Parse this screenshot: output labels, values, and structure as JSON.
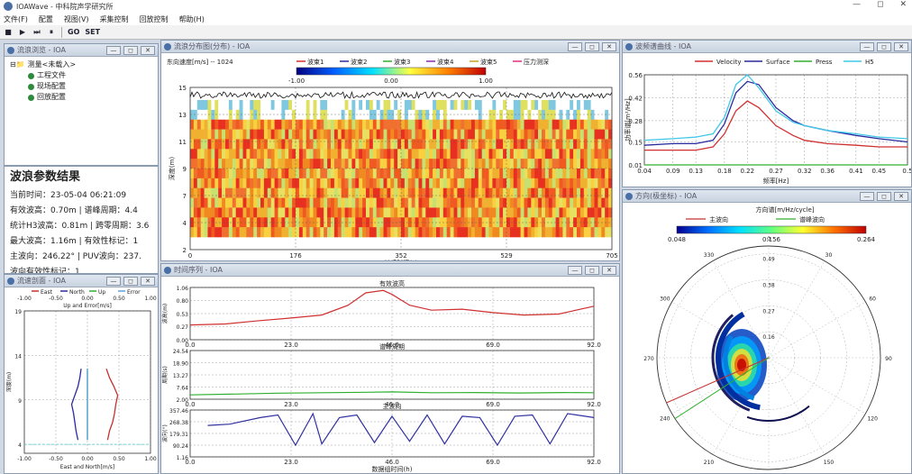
{
  "window": {
    "title": "IOAWave - 中科院声学研究所",
    "min": "—",
    "max": "◻",
    "close": "✕"
  },
  "menu": [
    "文件(F)",
    "配置",
    "视图(V)",
    "采集控制",
    "回放控制",
    "帮助(H)"
  ],
  "toolbar": {
    "go": "GO",
    "set": "SET"
  },
  "panels": {
    "tree": {
      "title": "流浪浏览 - IOA"
    },
    "heatmap": {
      "title": "流浪分布图(分布) - IOA"
    },
    "spectrum": {
      "title": "波频谱曲线 - IOA"
    },
    "direction": {
      "title": "方向(极坐标) - IOA"
    },
    "timeseries": {
      "title": "时间序列 - IOA"
    },
    "profile": {
      "title": "流速剖面 - IOA"
    }
  },
  "tree": {
    "root": "测量<未载入>",
    "items": [
      "工程文件",
      "现场配置",
      "回放配置"
    ]
  },
  "params": {
    "title": "波浪参数结果",
    "rows": [
      "当前时间：23-05-04 06:21:09",
      "有效波高：0.70m   | 谱峰周期：4.4",
      "统计H3波高：0.81m | 跨零周期：3.6",
      "最大波高：1.16m   | 有效性标记：1",
      "主波向：246.22°   | PUV波向：237.",
      "波向有效性标记：1"
    ]
  },
  "heatmap": {
    "caption": "东向速度[m/s] -- 1024",
    "legend": [
      "波束1",
      "波束2",
      "波束3",
      "波束4",
      "波束5",
      "压力测深"
    ],
    "colorbar_ticks": [
      "-1.00",
      "0.00",
      "1.00"
    ],
    "ylabel": "深度(m)",
    "xlabel": "持续时间(s)"
  },
  "spectrum_legend": [
    "Velocity",
    "Surface",
    "Press",
    "H5"
  ],
  "direction": {
    "title": "方向谱[m/Hz/cycle]",
    "legend": [
      "主波向",
      "谱峰波向"
    ],
    "colorbar_ticks": [
      "0.048",
      "0.156",
      "0.264"
    ]
  },
  "timeseries": {
    "titles": [
      "有效波高",
      "谱峰周期",
      "主波向"
    ],
    "xlabel": "数据组时间(h)"
  },
  "profile": {
    "legend": [
      "East",
      "North",
      "Up",
      "Error"
    ],
    "top_axis_title": "Up and Error[m/s]",
    "bottom_axis_title": "East and North[m/s]",
    "ylabel": "深度(m)"
  },
  "chart_data": [
    {
      "type": "heatmap",
      "title": "",
      "x_ticks": [
        "0",
        "176",
        "352",
        "529",
        "705"
      ],
      "y_ticks": [
        "2",
        "4",
        "7",
        "9",
        "11",
        "13",
        "15"
      ],
      "xlim": [
        0,
        705
      ],
      "ylim": [
        2,
        15
      ]
    },
    {
      "type": "line",
      "title": "",
      "xlabel": "频率[Hz]",
      "ylabel": "功率谱[m²/Hz]",
      "xlim": [
        0.04,
        0.5
      ],
      "ylim": [
        0.01,
        0.56
      ],
      "x_ticks": [
        "0.04",
        "0.09",
        "0.13",
        "0.18",
        "0.22",
        "0.27",
        "0.32",
        "0.36",
        "0.41",
        "0.45",
        "0.5"
      ],
      "y_ticks": [
        "0.01",
        "0.15",
        "0.28",
        "0.42",
        "0.56"
      ],
      "x": [
        0.04,
        0.09,
        0.13,
        0.16,
        0.18,
        0.2,
        0.22,
        0.24,
        0.27,
        0.3,
        0.32,
        0.36,
        0.41,
        0.45,
        0.5
      ],
      "series": [
        {
          "name": "Velocity",
          "color": "#d03030",
          "values": [
            0.1,
            0.1,
            0.1,
            0.12,
            0.2,
            0.34,
            0.4,
            0.36,
            0.25,
            0.19,
            0.16,
            0.14,
            0.13,
            0.12,
            0.12
          ]
        },
        {
          "name": "Surface",
          "color": "#2a2aa0",
          "values": [
            0.13,
            0.14,
            0.14,
            0.16,
            0.26,
            0.45,
            0.52,
            0.5,
            0.36,
            0.28,
            0.25,
            0.22,
            0.19,
            0.17,
            0.15
          ]
        },
        {
          "name": "Press",
          "color": "#30b030",
          "values": [
            0.01,
            0.01,
            0.01,
            0.01,
            0.01,
            0.01,
            0.01,
            0.01,
            0.01,
            0.01,
            0.01,
            0.01,
            0.01,
            0.01,
            0.01
          ]
        },
        {
          "name": "H5",
          "color": "#40c8e8",
          "values": [
            0.16,
            0.17,
            0.18,
            0.2,
            0.3,
            0.5,
            0.56,
            0.48,
            0.34,
            0.27,
            0.25,
            0.22,
            0.2,
            0.18,
            0.17
          ]
        }
      ]
    },
    {
      "type": "line",
      "title": "有效波高",
      "ylabel": "波高(m)",
      "xlim": [
        0,
        92
      ],
      "ylim": [
        0,
        1.06
      ],
      "x_ticks": [
        "0.0",
        "23.0",
        "46.0",
        "69.0",
        "92.0"
      ],
      "y_ticks": [
        "0.00",
        "0.27",
        "0.53",
        "0.80",
        "1.06"
      ],
      "x": [
        0,
        8,
        15,
        23,
        30,
        36,
        40,
        44,
        46,
        50,
        55,
        62,
        69,
        76,
        84,
        92
      ],
      "values": [
        0.3,
        0.32,
        0.38,
        0.44,
        0.5,
        0.7,
        0.95,
        1.0,
        0.92,
        0.7,
        0.6,
        0.62,
        0.55,
        0.5,
        0.52,
        0.68
      ],
      "color": "#d03030"
    },
    {
      "type": "line",
      "title": "谱峰周期",
      "ylabel": "周期(s)",
      "xlim": [
        0,
        92
      ],
      "ylim": [
        2.0,
        24.54
      ],
      "x_ticks": [
        "0.0",
        "23.0",
        "46.0",
        "69.0",
        "92.0"
      ],
      "y_ticks": [
        "2.00",
        "7.64",
        "13.27",
        "18.90",
        "24.54"
      ],
      "x": [
        0,
        10,
        20,
        30,
        40,
        46,
        55,
        65,
        75,
        85,
        92
      ],
      "values": [
        4.0,
        4.4,
        4.8,
        5.0,
        5.2,
        5.4,
        5.0,
        5.1,
        4.9,
        5.1,
        5.0
      ],
      "color": "#30b030"
    },
    {
      "type": "line",
      "title": "主波向",
      "ylabel": "波向(°)",
      "xlim": [
        0,
        92
      ],
      "ylim": [
        1.16,
        357.46
      ],
      "x_ticks": [
        "0.0",
        "23.0",
        "46.0",
        "69.0",
        "92.0"
      ],
      "y_ticks": [
        "1.16",
        "90.24",
        "179.31",
        "268.38",
        "357.46"
      ],
      "x": [
        4,
        9,
        16,
        20,
        24,
        28,
        30,
        34,
        38,
        42,
        46,
        50,
        54,
        58,
        62,
        66,
        70,
        74,
        78,
        82,
        86,
        92
      ],
      "values": [
        240,
        250,
        300,
        320,
        90,
        330,
        100,
        300,
        320,
        110,
        310,
        120,
        320,
        100,
        310,
        300,
        90,
        310,
        320,
        100,
        330,
        300
      ],
      "color": "#3030a0"
    },
    {
      "type": "scatter",
      "title": "",
      "ylabel": "深度(m)",
      "y_ticks": [
        "4",
        "9",
        "14",
        "19"
      ],
      "x_ticks_bottom": [
        "-1.00",
        "-0.50",
        "0.00",
        "0.50",
        "1.00"
      ],
      "x_ticks_top": [
        "-1.00",
        "-0.50",
        "0.00",
        "0.50",
        "1.00"
      ],
      "xlim": [
        -1.0,
        1.0
      ],
      "ylim": [
        3,
        19
      ],
      "depth": [
        12.5,
        11.5,
        10.5,
        9.5,
        8.5,
        7.5,
        6.5,
        5.5,
        4.5
      ],
      "series": [
        {
          "name": "East",
          "color": "#c83030",
          "values": [
            0.3,
            0.35,
            0.42,
            0.48,
            0.45,
            0.43,
            0.4,
            0.35,
            0.32
          ]
        },
        {
          "name": "North",
          "color": "#2a2aa0",
          "values": [
            -0.1,
            -0.12,
            -0.15,
            -0.2,
            -0.25,
            -0.22,
            -0.2,
            -0.18,
            -0.15
          ]
        },
        {
          "name": "Up",
          "color": "#30b030",
          "values": [
            0.0,
            0.0,
            0.0,
            0.0,
            0.0,
            0.0,
            0.0,
            0.0,
            0.0
          ]
        },
        {
          "name": "Error",
          "color": "#5aa0e0",
          "values": [
            0.0,
            0.0,
            0.0,
            0.0,
            0.0,
            0.0,
            0.0,
            0.0,
            0.0
          ]
        }
      ]
    },
    {
      "type": "heatmap",
      "title": "方向谱[m/Hz/cycle]",
      "angle_ticks": [
        "0",
        "30",
        "60",
        "90",
        "120",
        "150",
        "180",
        "210",
        "240",
        "270",
        "300",
        "330"
      ],
      "radial_ticks": [
        "0.16",
        "0.27",
        "0.38",
        "0.49"
      ],
      "main_direction": 246.22
    }
  ]
}
